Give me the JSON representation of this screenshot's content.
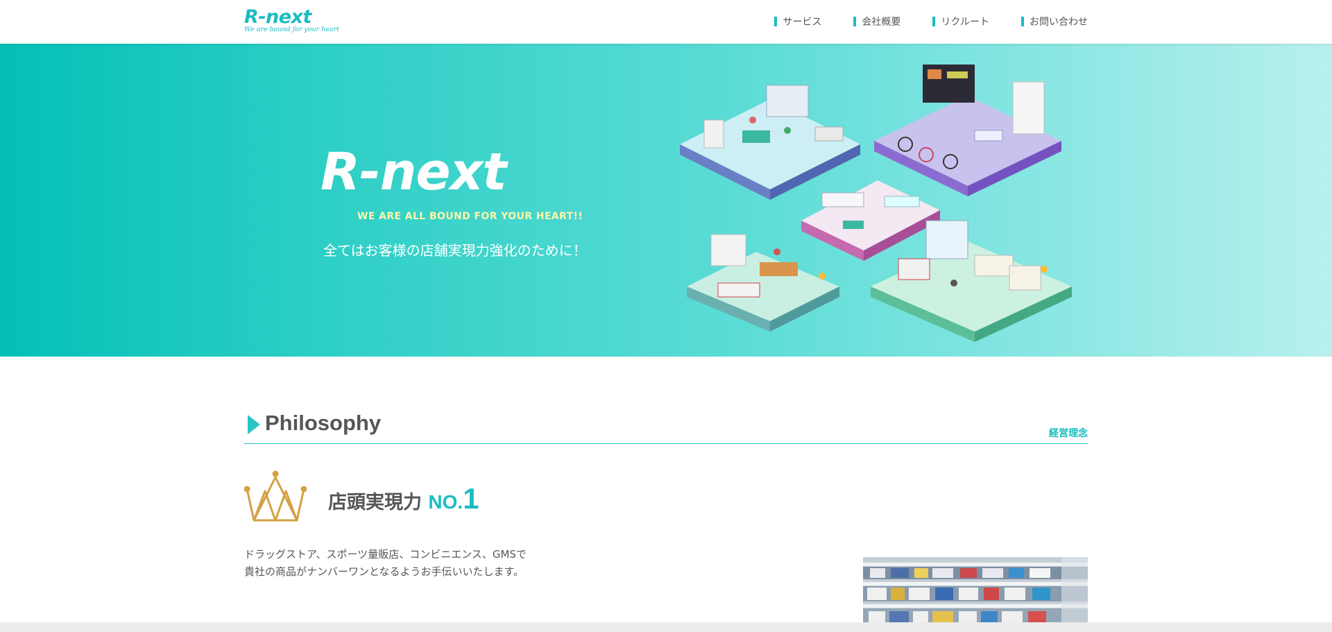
{
  "header": {
    "logo_main": "R-next",
    "logo_sub": "We are bound for your heart",
    "nav": [
      {
        "label": "サービス"
      },
      {
        "label": "会社概要"
      },
      {
        "label": "リクルート"
      },
      {
        "label": "お問い合わせ"
      }
    ]
  },
  "hero": {
    "logo": "R-next",
    "tagline": "WE ARE ALL BOUND FOR YOUR HEART!!",
    "copy": "全てはお客様の店舗実現力強化のために！"
  },
  "philosophy": {
    "title": "Philosophy",
    "subtitle": "経営理念",
    "feature_title": "店頭実現力",
    "feature_no": "NO.",
    "feature_one": "1",
    "description_line1": "ドラッグストア、スポーツ量販店、コンビニエンス、GMSで",
    "description_line2": "貴社の商品がナンバーワンとなるようお手伝いいたします。"
  },
  "colors": {
    "accent": "#1bbcc1",
    "hero_start": "#04c0b6",
    "hero_end": "#b8f0ee",
    "crown": "#d4a040",
    "tagline": "#fff6a8"
  },
  "icons": {
    "section_marker": "triangle-arrow-icon",
    "feature": "crown-icon"
  }
}
